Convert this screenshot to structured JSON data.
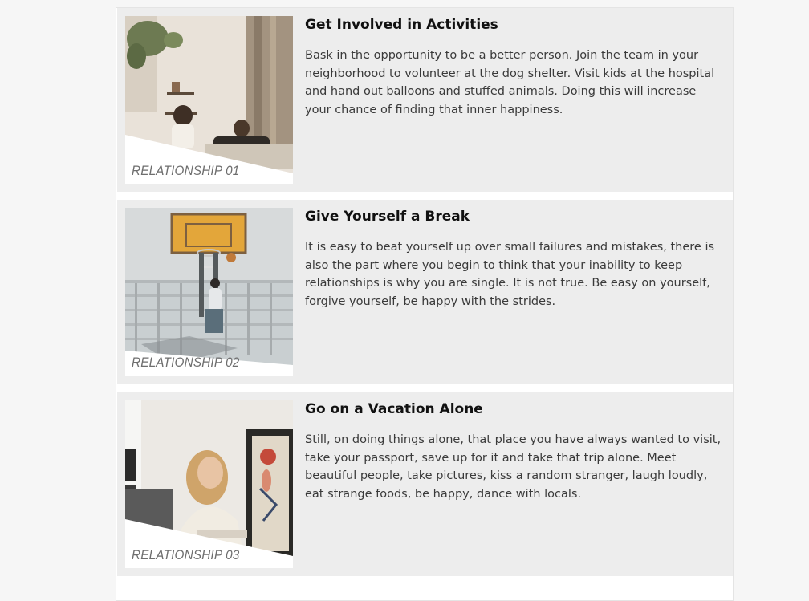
{
  "cards": [
    {
      "title": "Get Involved in Activities",
      "body": "Bask in the opportunity to be a better person. Join the team in your neighborhood to volunteer at the dog shelter. Visit kids at the hospital and hand out balloons and stuffed animals. Doing this will increase your chance of finding that inner happiness.",
      "image_caption": "RELATIONSHIP 01"
    },
    {
      "title": "Give Yourself a Break",
      "body": "It is easy to beat yourself up over small failures and mistakes, there is also the part where you begin to think that your inability to keep relationships is why you are single. It is not true. Be easy on yourself, forgive yourself, be happy with the strides.",
      "image_caption": "RELATIONSHIP 02"
    },
    {
      "title": "Go on a Vacation Alone",
      "body": "Still, on doing things alone, that place you have always wanted to visit, take your passport, save up for it and take that trip alone. Meet beautiful people, take pictures, kiss a random stranger, laugh loudly, eat strange foods, be happy, dance with locals.",
      "image_caption": "RELATIONSHIP 03"
    }
  ],
  "colors": {
    "page_background": "#f6f6f6",
    "card_background": "#ededed",
    "title_text": "#111111",
    "body_text": "#3a3a3a",
    "caption_text": "#6e6e6e"
  }
}
